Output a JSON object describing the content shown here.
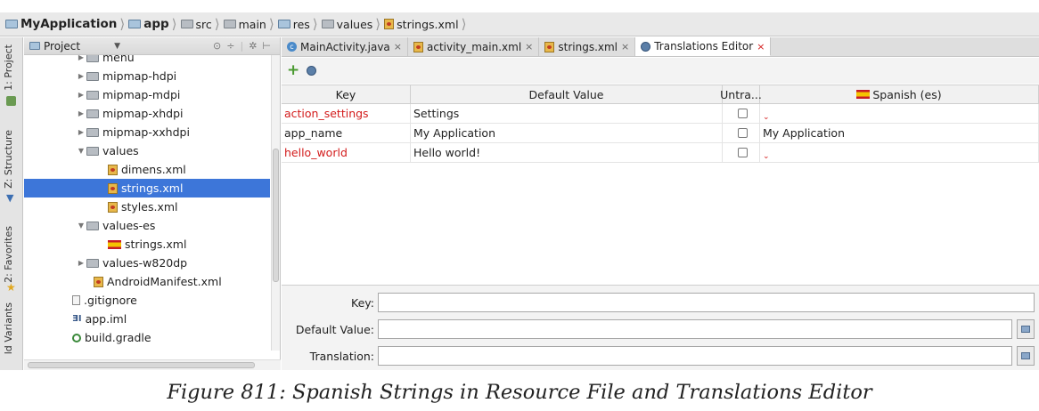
{
  "breadcrumb": [
    "MyApplication",
    "app",
    "src",
    "main",
    "res",
    "values",
    "strings.xml"
  ],
  "left_bar": {
    "tabs": [
      "1: Project",
      "Z: Structure",
      "2: Favorites",
      "ld Variants"
    ]
  },
  "project_panel": {
    "title": "Project",
    "tree": [
      {
        "label": "menu",
        "icon": "folder-icon",
        "arrow": "collapsed"
      },
      {
        "label": "mipmap-hdpi",
        "icon": "folder-icon",
        "arrow": "collapsed"
      },
      {
        "label": "mipmap-mdpi",
        "icon": "folder-icon",
        "arrow": "collapsed"
      },
      {
        "label": "mipmap-xhdpi",
        "icon": "folder-icon",
        "arrow": "collapsed"
      },
      {
        "label": "mipmap-xxhdpi",
        "icon": "folder-icon",
        "arrow": "collapsed"
      },
      {
        "label": "values",
        "icon": "folder-icon",
        "arrow": "expanded"
      },
      {
        "label": "dimens.xml",
        "icon": "xml-file-icon"
      },
      {
        "label": "strings.xml",
        "icon": "xml-file-icon",
        "selected": true
      },
      {
        "label": "styles.xml",
        "icon": "xml-file-icon"
      },
      {
        "label": "values-es",
        "icon": "folder-icon",
        "arrow": "expanded"
      },
      {
        "label": "strings.xml",
        "icon": "spanish-flag-icon"
      },
      {
        "label": "values-w820dp",
        "icon": "folder-icon",
        "arrow": "collapsed"
      },
      {
        "label": "AndroidManifest.xml",
        "icon": "xml-file-icon"
      },
      {
        "label": ".gitignore",
        "icon": "text-file-icon"
      },
      {
        "label": "app.iml",
        "icon": "iml-file-icon"
      },
      {
        "label": "build.gradle",
        "icon": "gradle-file-icon"
      }
    ]
  },
  "tabs": [
    {
      "label": "MainActivity.java",
      "icon": "java-class-icon",
      "active": false
    },
    {
      "label": "activity_main.xml",
      "icon": "xml-file-icon",
      "active": false
    },
    {
      "label": "strings.xml",
      "icon": "xml-file-icon",
      "active": false
    },
    {
      "label": "Translations Editor",
      "icon": "globe-icon",
      "active": true
    }
  ],
  "translations": {
    "columns": [
      "Key",
      "Default Value",
      "Untra...",
      "Spanish (es)"
    ],
    "rows": [
      {
        "key": "action_settings",
        "default": "Settings",
        "untranslatable": false,
        "spanish": "",
        "missing": true
      },
      {
        "key": "app_name",
        "default": "My Application",
        "untranslatable": false,
        "spanish": "My Application",
        "missing": false
      },
      {
        "key": "hello_world",
        "default": "Hello world!",
        "untranslatable": false,
        "spanish": "",
        "missing": true
      }
    ],
    "missing_color": "#d31b1b"
  },
  "form": {
    "key_label": "Key:",
    "default_label": "Default Value:",
    "translation_label": "Translation:",
    "key_value": "",
    "default_value": "",
    "translation_value": ""
  },
  "caption": "Figure 811: Spanish Strings in Resource File and Translations Editor"
}
